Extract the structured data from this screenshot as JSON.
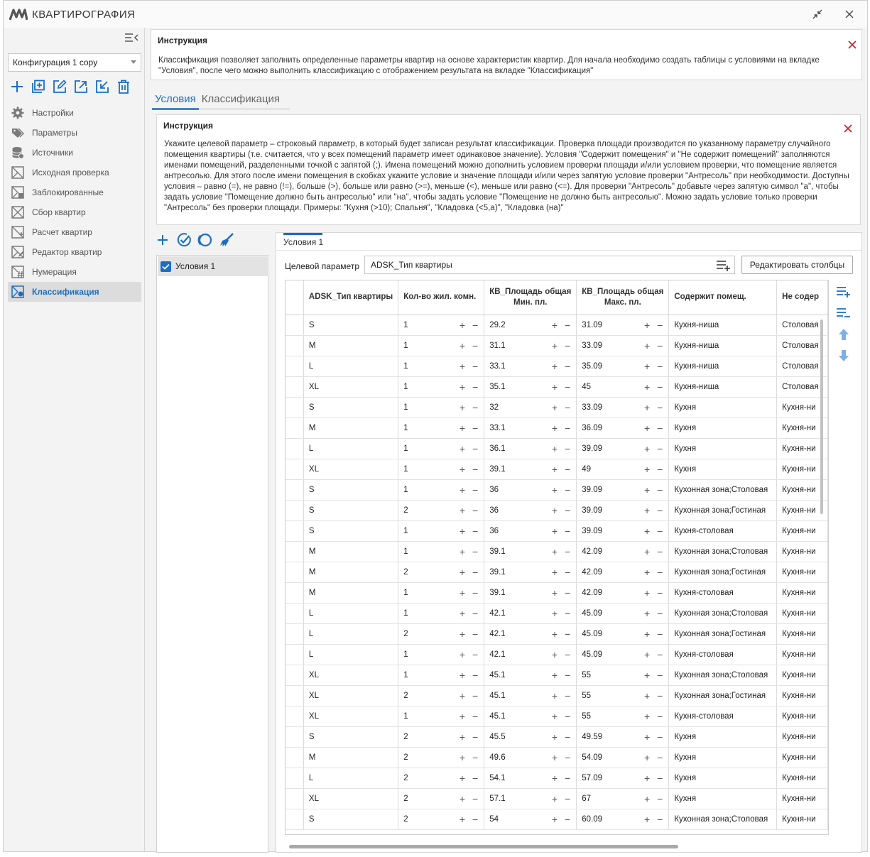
{
  "app": {
    "title": "КВАРТИРОГРАФИЯ"
  },
  "sidebar": {
    "config_value": "Конфигурация 1 copy",
    "items": [
      {
        "label": "Настройки",
        "icon": "gear-icon"
      },
      {
        "label": "Параметры",
        "icon": "tags-icon"
      },
      {
        "label": "Источники",
        "icon": "database-icon"
      },
      {
        "label": "Исходная проверка",
        "icon": "check-box-icon"
      },
      {
        "label": "Заблокированные",
        "icon": "lock-box-icon"
      },
      {
        "label": "Сбор квартир",
        "icon": "collect-icon"
      },
      {
        "label": "Расчет квартир",
        "icon": "calc-icon"
      },
      {
        "label": "Редактор квартир",
        "icon": "edit-box-icon"
      },
      {
        "label": "Нумерация",
        "icon": "hash-icon"
      },
      {
        "label": "Классификация",
        "icon": "classify-icon"
      }
    ]
  },
  "instruction_top": {
    "title": "Инструкция",
    "text": "Классификация позволяет заполнить определенные параметры квартир на основе характеристик квартир. Для начала необходимо создать таблицы с условиями на вкладке \"Условия\", после чего можно выполнить классификацию с отображением результата на вкладке \"Классификация\""
  },
  "tabs": [
    "Условия",
    "Классификация"
  ],
  "instruction_inner": {
    "title": "Инструкция",
    "text": "Укажите целевой параметр – строковый параметр, в который будет записан результат классификации. Проверка площади производится по указанному параметру случайного помещения квартиры (т.е. считается, что у всех помещений параметр имеет одинаковое значение). Условия \"Содержит помещения\" и \"Не содержит помещений\" заполняются именами помещений, разделенными точкой с запятой (;). Имена помещений можно дополнить условием проверки площади и/или условием проверки, что помещение является антресолью. Для этого после имени помещения в скобках укажите условие и значение площади и/или через запятую условие проверки \"Антресоль\" при необходимости. Доступны условия – равно (=), не равно (!=), больше (>), больше или равно (>=), меньше (<), меньше или равно (<=). Для проверки \"Антресоль\" добавьте через запятую символ \"а\", чтобы задать условие \"Помещение должно быть антресолью\" или \"на\", чтобы задать условие \"Помещение не должно быть антресолью\". Можно задать условие только проверки \"Антресоль\" без проверки площади. Примеры: \"Кухня (>10); Спальня\", \"Кладовка (<5,а)\", \"Кладовка (на)\""
  },
  "conditions": [
    {
      "label": "Условия 1",
      "checked": true
    }
  ],
  "editor": {
    "tab_label": "Условия 1",
    "target_label": "Целевой параметр",
    "target_value": "ADSK_Тип квартиры",
    "edit_columns_label": "Редактировать столбцы"
  },
  "table": {
    "headers": {
      "type": "ADSK_Тип квартиры",
      "rooms": "Кол-во жил. комн.",
      "min1": "КВ_Площадь общая",
      "min2": "Мин. пл.",
      "max1": "КВ_Площадь общая",
      "max2": "Макс. пл.",
      "contains": "Содержит помещ.",
      "notcontains": "Не содер"
    },
    "rows": [
      [
        "S",
        "1",
        "29.2",
        "31.09",
        "Кухня-ниша",
        "Столовая"
      ],
      [
        "M",
        "1",
        "31.1",
        "33.09",
        "Кухня-ниша",
        "Столовая"
      ],
      [
        "L",
        "1",
        "33.1",
        "35.09",
        "Кухня-ниша",
        "Столовая"
      ],
      [
        "XL",
        "1",
        "35.1",
        "45",
        "Кухня-ниша",
        "Столовая"
      ],
      [
        "S",
        "1",
        "32",
        "33.09",
        "Кухня",
        "Кухня-ни"
      ],
      [
        "M",
        "1",
        "33.1",
        "36.09",
        "Кухня",
        "Кухня-ни"
      ],
      [
        "L",
        "1",
        "36.1",
        "39.09",
        "Кухня",
        "Кухня-ни"
      ],
      [
        "XL",
        "1",
        "39.1",
        "49",
        "Кухня",
        "Кухня-ни"
      ],
      [
        "S",
        "1",
        "36",
        "39.09",
        "Кухонная зона;Столовая",
        "Кухня-ни"
      ],
      [
        "S",
        "2",
        "36",
        "39.09",
        "Кухонная зона;Гостиная",
        "Кухня-ни"
      ],
      [
        "S",
        "1",
        "36",
        "39.09",
        "Кухня-столовая",
        "Кухня-ни"
      ],
      [
        "M",
        "1",
        "39.1",
        "42.09",
        "Кухонная зона;Столовая",
        "Кухня-ни"
      ],
      [
        "M",
        "2",
        "39.1",
        "42.09",
        "Кухонная зона;Гостиная",
        "Кухня-ни"
      ],
      [
        "M",
        "1",
        "39.1",
        "42.09",
        "Кухня-столовая",
        "Кухня-ни"
      ],
      [
        "L",
        "1",
        "42.1",
        "45.09",
        "Кухонная зона;Столовая",
        "Кухня-ни"
      ],
      [
        "L",
        "2",
        "42.1",
        "45.09",
        "Кухонная зона;Гостиная",
        "Кухня-ни"
      ],
      [
        "L",
        "1",
        "42.1",
        "45.09",
        "Кухня-столовая",
        "Кухня-ни"
      ],
      [
        "XL",
        "1",
        "45.1",
        "55",
        "Кухонная зона;Столовая",
        "Кухня-ни"
      ],
      [
        "XL",
        "2",
        "45.1",
        "55",
        "Кухонная зона;Гостиная",
        "Кухня-ни"
      ],
      [
        "XL",
        "1",
        "45.1",
        "55",
        "Кухня-столовая",
        "Кухня-ни"
      ],
      [
        "S",
        "2",
        "45.5",
        "49.59",
        "Кухня",
        "Кухня-ни"
      ],
      [
        "M",
        "2",
        "49.6",
        "54.09",
        "Кухня",
        "Кухня-ни"
      ],
      [
        "L",
        "2",
        "54.1",
        "57.09",
        "Кухня",
        "Кухня-ни"
      ],
      [
        "XL",
        "2",
        "57.1",
        "67",
        "Кухня",
        "Кухня-ни"
      ],
      [
        "S",
        "2",
        "54",
        "60.09",
        "Кухонная зона;Столовая",
        "Кухня-ни"
      ]
    ]
  },
  "colors": {
    "accent": "#1a6fc4",
    "close": "#d9232e"
  }
}
